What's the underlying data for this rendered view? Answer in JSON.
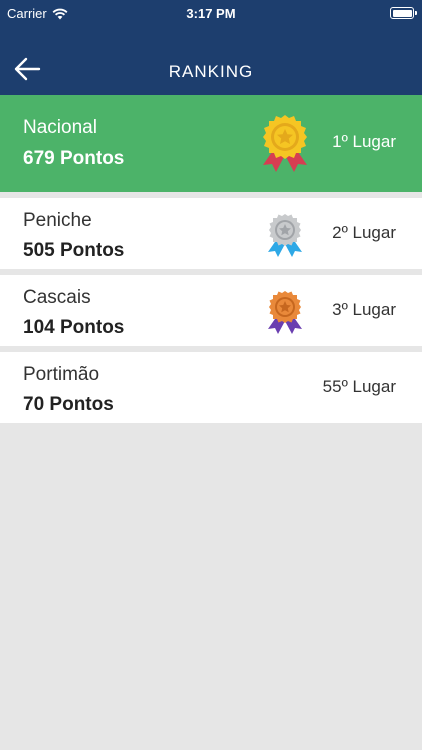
{
  "status_bar": {
    "carrier": "Carrier",
    "time": "3:17 PM"
  },
  "nav": {
    "title": "RANKING",
    "back_icon": "arrow-left-icon"
  },
  "colors": {
    "header": "#1d3e6e",
    "first_place_bg": "#4cb369",
    "background": "#e6e6e6"
  },
  "ranking": [
    {
      "name": "Nacional",
      "points": "679 Pontos",
      "place": "1º Lugar",
      "medal": "gold"
    },
    {
      "name": "Peniche",
      "points": "505 Pontos",
      "place": "2º Lugar",
      "medal": "silver"
    },
    {
      "name": "Cascais",
      "points": "104 Pontos",
      "place": "3º Lugar",
      "medal": "bronze"
    },
    {
      "name": "Portimão",
      "points": "70 Pontos",
      "place": "55º Lugar",
      "medal": "none"
    }
  ]
}
